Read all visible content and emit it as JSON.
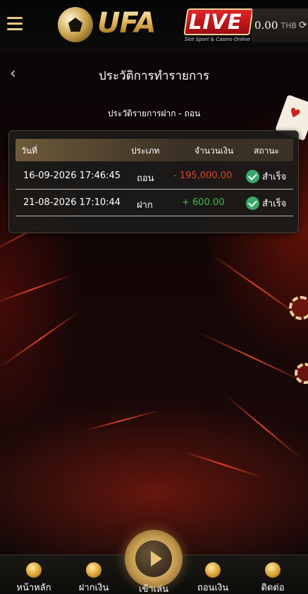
{
  "header": {
    "logo_brand": "UFA",
    "logo_live": "LIVE",
    "logo_tagline": "Slot Sport & Casino Online",
    "balance_amount": "0.00",
    "balance_currency": "THB"
  },
  "page": {
    "title": "ประวัติการทำรายการ",
    "section_title": "ประวัติรายการฝาก - ถอน"
  },
  "table": {
    "headers": [
      "วันที่",
      "ประเภท",
      "จำนวนเงิน",
      "สถานะ"
    ],
    "rows": [
      {
        "date": "16-09-2026 17:46:45",
        "type": "ถอน",
        "amount": "- 195,000.00",
        "status": "สำเร็จ"
      },
      {
        "date": "21-08-2026 17:10:44",
        "type": "ฝาก",
        "amount": "+ 600.00",
        "status": "สำเร็จ"
      }
    ]
  },
  "nav": {
    "home": "หน้าหลัก",
    "deposit": "ฝากเงิน",
    "play": "เข้าเล่น",
    "withdraw": "ถอนเงิน",
    "contact": "ติดต่อ"
  },
  "colors": {
    "gold": "#e9c98a",
    "negative": "#e0442a",
    "positive": "#3cbf4a",
    "success": "#3aa86a"
  }
}
